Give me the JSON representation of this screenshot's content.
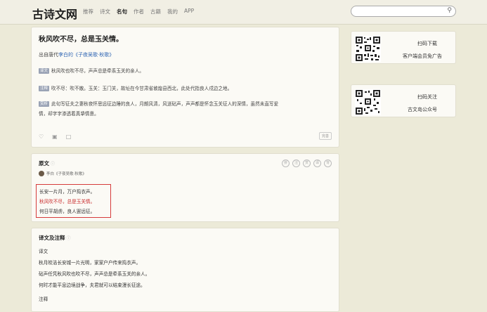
{
  "header": {
    "logo": "古诗文网",
    "nav": [
      "推荐",
      "诗文",
      "名句",
      "作者",
      "古籍",
      "我的",
      "APP"
    ],
    "active_nav": "名句",
    "search_placeholder": ""
  },
  "quote_card": {
    "title": "秋风吹不尽，总是玉关情。",
    "source_prefix": "出自唐代",
    "source_author": "李白",
    "source_work": "的《子夜吴歌·秋歌》",
    "lines": [
      {
        "tag": "译文",
        "text": "秋风吹也吹不尽，声声总是牵系玉关的亲人。"
      },
      {
        "tag": "注释",
        "text": "吹不尽：吹不散。玉关：玉门关，故址在今甘肃省敦煌县西北，此处代指良人戍边之地。"
      },
      {
        "tag": "赏析",
        "text": "此句写征夫之妻秋夜怀思远征边陲的良人，月朗风清，风送砧声，声声都是怀念玉关征人的深情，虽然未直写爱"
      },
      {
        "tag": "",
        "text": "情，却字字渗透着真挚情意。"
      }
    ],
    "badge": "完善"
  },
  "original": {
    "header": "原文",
    "author_line": "李白《子夜吴歌·秋歌》",
    "buttons": [
      "拼",
      "注",
      "赏",
      "译",
      "背"
    ],
    "poem_lines": [
      {
        "text": "长安一片月，万户捣衣声。",
        "highlight": false
      },
      {
        "text": "秋风吹不尽，总是玉关情。",
        "highlight": true
      },
      {
        "text": "何日平胡虏，良人罢远征。",
        "highlight": false
      }
    ]
  },
  "translation": {
    "header": "译文及注释",
    "sub": "译文",
    "lines": [
      "秋月皎洁长安城一片光明，家家户户传来捣衣声。",
      "砧声任凭秋风吹也吹不尽，声声总是牵系玉关的亲人。",
      "何时才能平息边境战争，夫君就可以结束漫长征途。"
    ],
    "sub2": "注释"
  },
  "sidebar": {
    "download": {
      "line1": "扫码下载",
      "line2": "客户端会员免广告"
    },
    "follow": {
      "line1": "扫码关注",
      "line2": "古文岛公众号"
    }
  }
}
